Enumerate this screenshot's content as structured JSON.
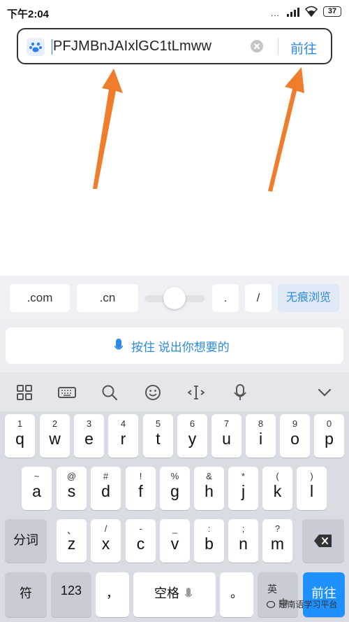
{
  "status_bar": {
    "time": "下午2:04",
    "battery": "37",
    "dots": "..."
  },
  "address_bar": {
    "url_text": "PFJMBnJAIxlGC1tLmww",
    "go_label": "前往"
  },
  "quick_bar": {
    "dotcom": ".com",
    "dotcn": ".cn",
    "dot": ".",
    "slash": "/",
    "incognito": "无痕浏览"
  },
  "voice_bar": {
    "label": "按住 说出你想要的"
  },
  "keys": {
    "row1": [
      {
        "sub": "1",
        "main": "q"
      },
      {
        "sub": "2",
        "main": "w"
      },
      {
        "sub": "3",
        "main": "e"
      },
      {
        "sub": "4",
        "main": "r"
      },
      {
        "sub": "5",
        "main": "t"
      },
      {
        "sub": "6",
        "main": "y"
      },
      {
        "sub": "7",
        "main": "u"
      },
      {
        "sub": "8",
        "main": "i"
      },
      {
        "sub": "9",
        "main": "o"
      },
      {
        "sub": "0",
        "main": "p"
      }
    ],
    "row2": [
      {
        "sub": "~",
        "main": "a"
      },
      {
        "sub": "@",
        "main": "s"
      },
      {
        "sub": "#",
        "main": "d"
      },
      {
        "sub": "!",
        "main": "f"
      },
      {
        "sub": "%",
        "main": "g"
      },
      {
        "sub": "&",
        "main": "h"
      },
      {
        "sub": "*",
        "main": "j"
      },
      {
        "sub": "(",
        "main": "k"
      },
      {
        "sub": ")",
        "main": "l"
      }
    ],
    "row3": [
      {
        "sub": "、",
        "main": "z"
      },
      {
        "sub": "/",
        "main": "x"
      },
      {
        "sub": "-",
        "main": "c"
      },
      {
        "sub": "_",
        "main": "v"
      },
      {
        "sub": ":",
        "main": "b"
      },
      {
        "sub": ";",
        "main": "n"
      },
      {
        "sub": "?",
        "main": "m"
      }
    ],
    "fenci": "分词",
    "fu": "符",
    "num": "123",
    "comma": "，",
    "space": "空格",
    "period": "。",
    "lang_top": "英",
    "lang_bottom": "中",
    "go": "前往"
  },
  "watermark": "越南语学习平台",
  "colors": {
    "accent": "#2a8ae6",
    "arrow": "#f07d2b",
    "go_key": "#1e90ff"
  }
}
